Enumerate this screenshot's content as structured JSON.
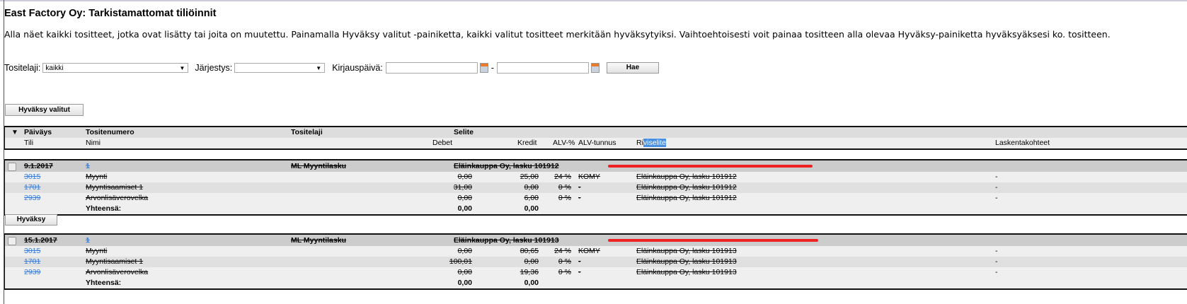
{
  "page": {
    "title": "East Factory Oy: Tarkistamattomat tiliöinnit",
    "description": "Alla näet kaikki tositteet, jotka ovat lisätty tai joita on muutettu.  Painamalla Hyväksy valitut -painiketta, kaikki valitut tositteet merkitään hyväksytyiksi. Vaihtoehtoisesti voit painaa tositteen alla olevaa Hyväksy-painiketta hyväksyäksesi ko. tositteen."
  },
  "filters": {
    "tositelaji_label": "Tositelaji:",
    "tositelaji_value": "kaikki",
    "jarjestys_label": "Järjestys:",
    "jarjestys_value": "",
    "kirjauspaiva_label": "Kirjauspäivä:",
    "date_from": "",
    "date_to": "",
    "separator": "-",
    "search_button": "Hae"
  },
  "approve_selected_button": "Hyväksy valitut",
  "approve_button": "Hyväksy",
  "header": {
    "paivays": "Päiväys",
    "tositenumero": "Tositenumero",
    "tositelaji": "Tositelaji",
    "selite": "Selite",
    "tili": "Tili",
    "nimi": "Nimi",
    "debet": "Debet",
    "kredit": "Kredit",
    "alv_pct": "ALV-%",
    "alv_tunnus": "ALV-tunnus",
    "riviselite_pre": "Ri",
    "riviselite_sel": "viselite",
    "laskentakohteet": "Laskentakohteet"
  },
  "totals_label": "Yhteensä:",
  "colors": {
    "annotation_red": "#ee2222",
    "link": "#3a7bd5"
  },
  "vouchers": [
    {
      "date": "9.1.2017",
      "number": "1",
      "type": "ML Myyntilasku",
      "description": "Eläinkauppa Oy, lasku 101912",
      "lines": [
        {
          "account": "3015",
          "name": "Myynti",
          "debet": "0,00",
          "kredit": "25,00",
          "alv_pct": "24 %",
          "alv_code": "KOMY",
          "line_desc": "Eläinkauppa Oy, lasku 101912",
          "cost_objects": "-"
        },
        {
          "account": "1701",
          "name": "Myyntisaamiset 1",
          "debet": "31,00",
          "kredit": "0,00",
          "alv_pct": "0 %",
          "alv_code": "-",
          "line_desc": "Eläinkauppa Oy, lasku 101912",
          "cost_objects": "-"
        },
        {
          "account": "2939",
          "name": "Arvonlisäverovelka",
          "debet": "0,00",
          "kredit": "6,00",
          "alv_pct": "0 %",
          "alv_code": "-",
          "line_desc": "Eläinkauppa Oy, lasku 101912",
          "cost_objects": "-"
        }
      ],
      "total_debet": "0,00",
      "total_kredit": "0,00"
    },
    {
      "date": "15.1.2017",
      "number": "1",
      "type": "ML Myyntilasku",
      "description": "Eläinkauppa Oy, lasku 101913",
      "lines": [
        {
          "account": "3015",
          "name": "Myynti",
          "debet": "0,00",
          "kredit": "80,65",
          "alv_pct": "24 %",
          "alv_code": "KOMY",
          "line_desc": "Eläinkauppa Oy, lasku 101913",
          "cost_objects": "-"
        },
        {
          "account": "1701",
          "name": "Myyntisaamiset 1",
          "debet": "100,01",
          "kredit": "0,00",
          "alv_pct": "0 %",
          "alv_code": "-",
          "line_desc": "Eläinkauppa Oy, lasku 101913",
          "cost_objects": "-"
        },
        {
          "account": "2939",
          "name": "Arvonlisäverovelka",
          "debet": "0,00",
          "kredit": "19,36",
          "alv_pct": "0 %",
          "alv_code": "-",
          "line_desc": "Eläinkauppa Oy, lasku 101913",
          "cost_objects": "-"
        }
      ],
      "total_debet": "0,00",
      "total_kredit": "0,00"
    }
  ]
}
